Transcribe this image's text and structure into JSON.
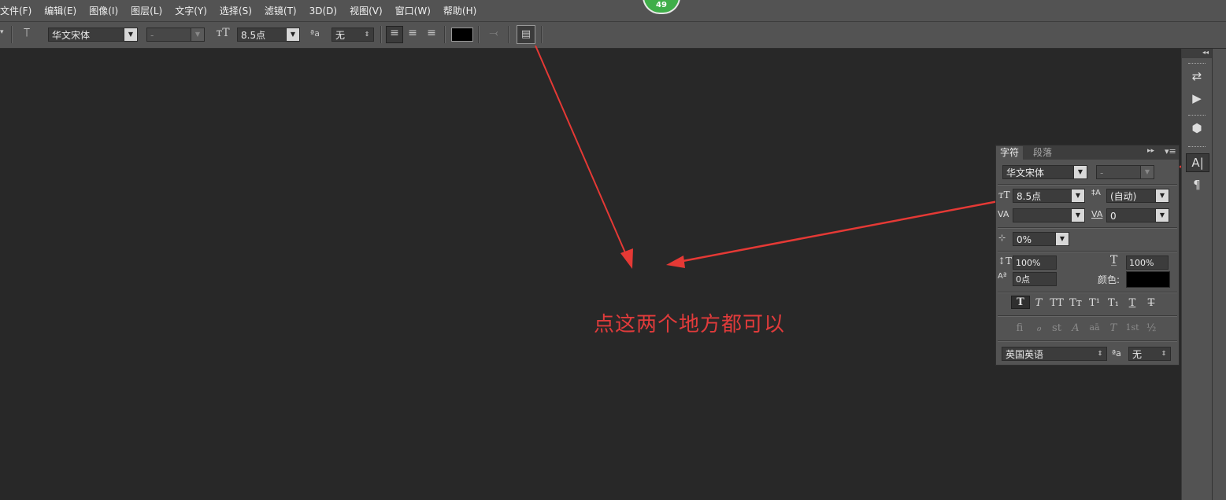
{
  "menu": [
    "文件(F)",
    "编辑(E)",
    "图像(I)",
    "图层(L)",
    "文字(Y)",
    "选择(S)",
    "滤镜(T)",
    "3D(D)",
    "视图(V)",
    "窗口(W)",
    "帮助(H)"
  ],
  "badge": "49",
  "options": {
    "font_family": "华文宋体",
    "font_style": "-",
    "font_size": "8.5点",
    "antialias": "无",
    "text_color": "#000000"
  },
  "annotation": "点这两个地方都可以",
  "panel": {
    "tab_character": "字符",
    "tab_paragraph": "段落",
    "font_family": "华文宋体",
    "font_style": "-",
    "size": "8.5点",
    "leading": "(自动)",
    "kerning": "",
    "tracking": "0",
    "tsume": "0%",
    "vertical_scale": "100%",
    "horizontal_scale": "100%",
    "baseline_shift": "0点",
    "color_label": "颜色:",
    "color": "#000000",
    "styles": [
      "T",
      "T",
      "TT",
      "Tт",
      "T¹",
      "T₁",
      "T",
      "T"
    ],
    "opentype": [
      "fi",
      "ℴ",
      "st",
      "A",
      "aā",
      "T",
      "1st",
      "½"
    ],
    "language": "英国英语",
    "antialias_label": "ªa",
    "antialias": "无"
  }
}
